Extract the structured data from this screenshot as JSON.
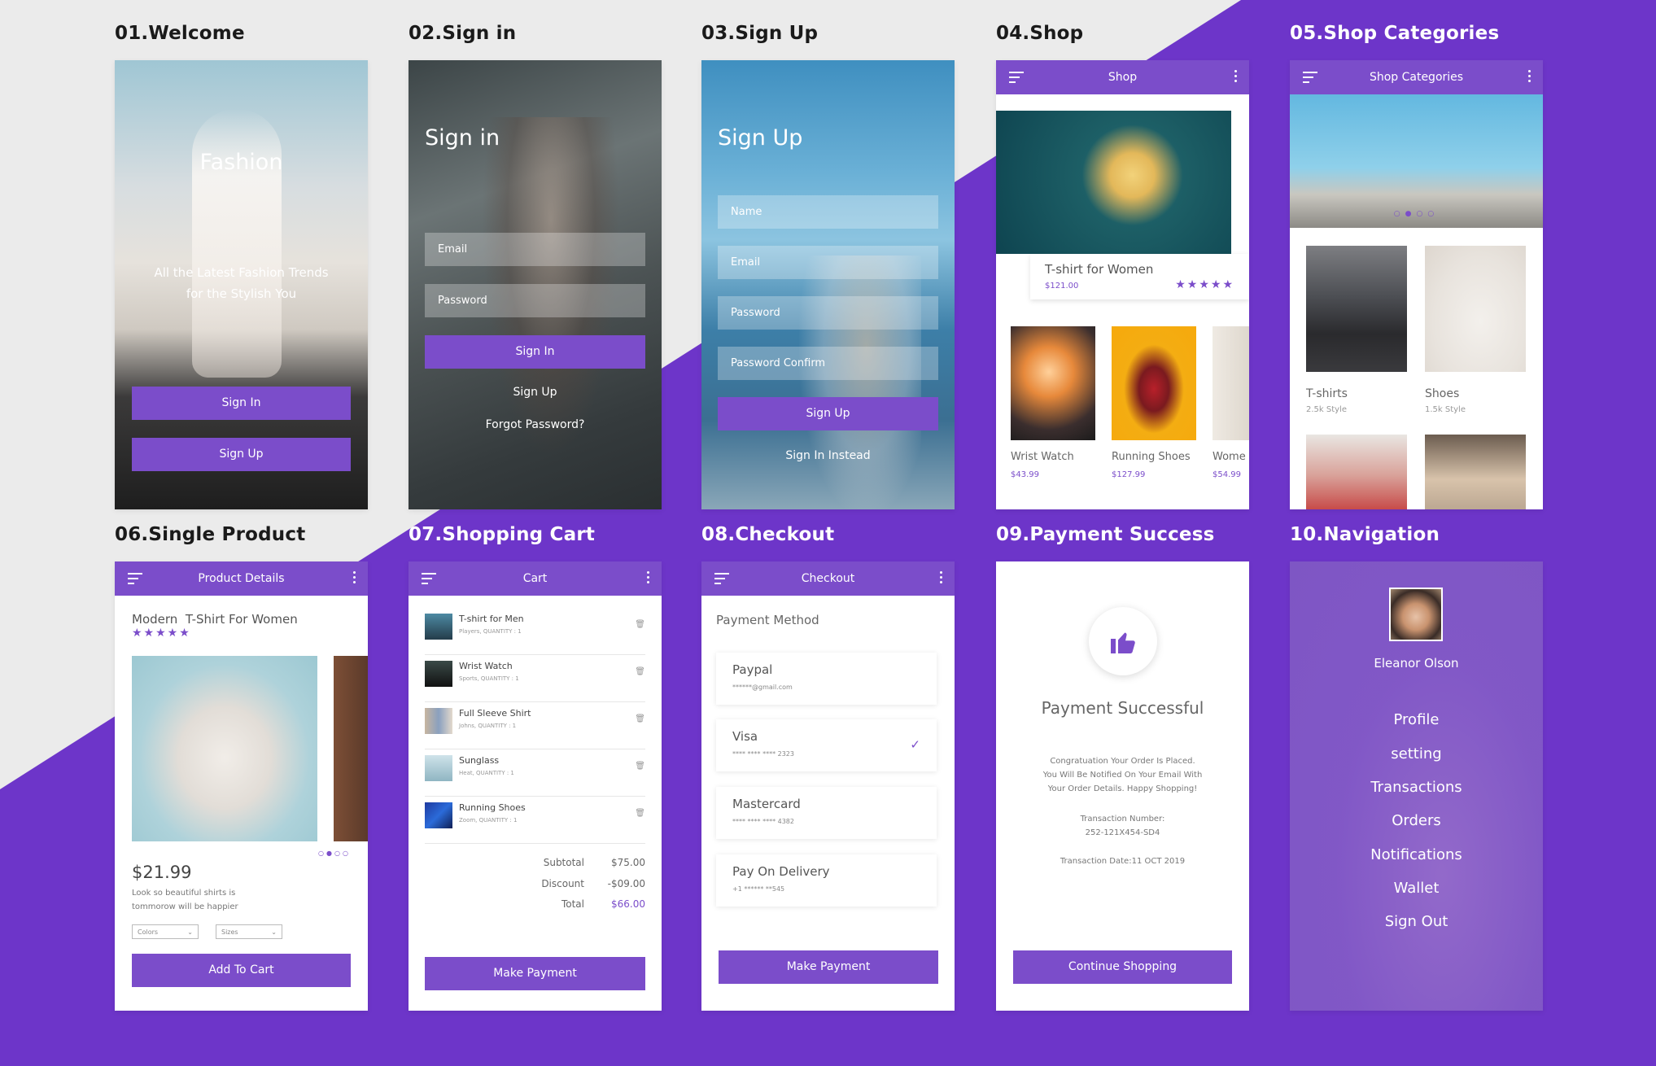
{
  "colors": {
    "accent": "#7b4dca",
    "background_purple": "#6d35c9",
    "background_grey": "#ebebeb"
  },
  "labels": [
    "01.Welcome",
    "02.Sign in",
    "03.Sign Up",
    "04.Shop",
    "05.Shop Categories",
    "06.Single Product",
    "07.Shopping Cart",
    "08.Checkout",
    "09.Payment Success",
    "10.Navigation"
  ],
  "welcome": {
    "title": "Fashion",
    "subtitle_1": "All the Latest Fashion Trends",
    "subtitle_2": "for the Stylish You",
    "sign_in": "Sign In",
    "sign_up": "Sign Up"
  },
  "signin": {
    "title": "Sign in",
    "email": "Email",
    "password": "Password",
    "sign_in": "Sign In",
    "sign_up": "Sign Up",
    "forgot": "Forgot Password?"
  },
  "signup": {
    "title": "Sign Up",
    "name": "Name",
    "email": "Email",
    "password": "Password",
    "confirm": "Password Confirm",
    "sign_up": "Sign Up",
    "instead": "Sign In Instead"
  },
  "shop": {
    "title": "Shop",
    "featured_name": "T-shirt for Women",
    "featured_price": "$121.00",
    "rating": "★★★★★",
    "items": [
      {
        "name": "Wrist Watch",
        "price": "$43.99"
      },
      {
        "name": "Running Shoes",
        "price": "$127.99"
      },
      {
        "name": "Wome",
        "price": "$54.99"
      }
    ]
  },
  "categories": {
    "title": "Shop Categories",
    "items": [
      {
        "name": "T-shirts",
        "count": "2.5k Style"
      },
      {
        "name": "Shoes",
        "count": "1.5k Style"
      }
    ]
  },
  "product": {
    "title": "Product Details",
    "name": "Modern  T-Shirt For Women",
    "rating": "★★★★★",
    "price": "$21.99",
    "desc_1": "Look so beautiful shirts is",
    "desc_2": "tommorow will be happier",
    "colors": "Colors",
    "sizes": "Sizes",
    "add": "Add To Cart"
  },
  "cart": {
    "title": "Cart",
    "items": [
      {
        "name": "T-shirt for Men",
        "sub": "Players, QUANTITY : 1"
      },
      {
        "name": "Wrist Watch",
        "sub": "Sports, QUANTITY : 1"
      },
      {
        "name": "Full Sleeve Shirt",
        "sub": "Johns, QUANTITY : 1"
      },
      {
        "name": "Sunglass",
        "sub": "Heat, QUANTITY : 1"
      },
      {
        "name": "Running Shoes",
        "sub": "Zoom, QUANTITY : 1"
      }
    ],
    "subtotal_label": "Subtotal",
    "subtotal": "$75.00",
    "discount_label": "Discount",
    "discount": "-$09.00",
    "total_label": "Total",
    "total": "$66.00",
    "pay": "Make Payment"
  },
  "checkout": {
    "title": "Checkout",
    "heading": "Payment Method",
    "methods": [
      {
        "name": "Paypal",
        "detail": "******@gmail.com"
      },
      {
        "name": "Visa",
        "detail": "**** **** **** 2323"
      },
      {
        "name": "Mastercard",
        "detail": "**** **** **** 4382"
      },
      {
        "name": "Pay On Delivery",
        "detail": "+1 ****** **545"
      }
    ],
    "check": "✓",
    "pay": "Make Payment"
  },
  "success": {
    "title": "Payment Successful",
    "msg_1": "Congratuation Your Order Is Placed.",
    "msg_2": "You Will Be Notified On Your Email With",
    "msg_3": "Your Order Details. Happy Shopping!",
    "txn_label": "Transaction Number:",
    "txn": "252-121X454-SD4",
    "date": "Transaction Date:11 OCT 2019",
    "btn": "Continue Shopping"
  },
  "navigation": {
    "user": "Eleanor Olson",
    "items": [
      "Profile",
      "setting",
      "Transactions",
      "Orders",
      "Notifications",
      "Wallet",
      "Sign Out"
    ]
  }
}
